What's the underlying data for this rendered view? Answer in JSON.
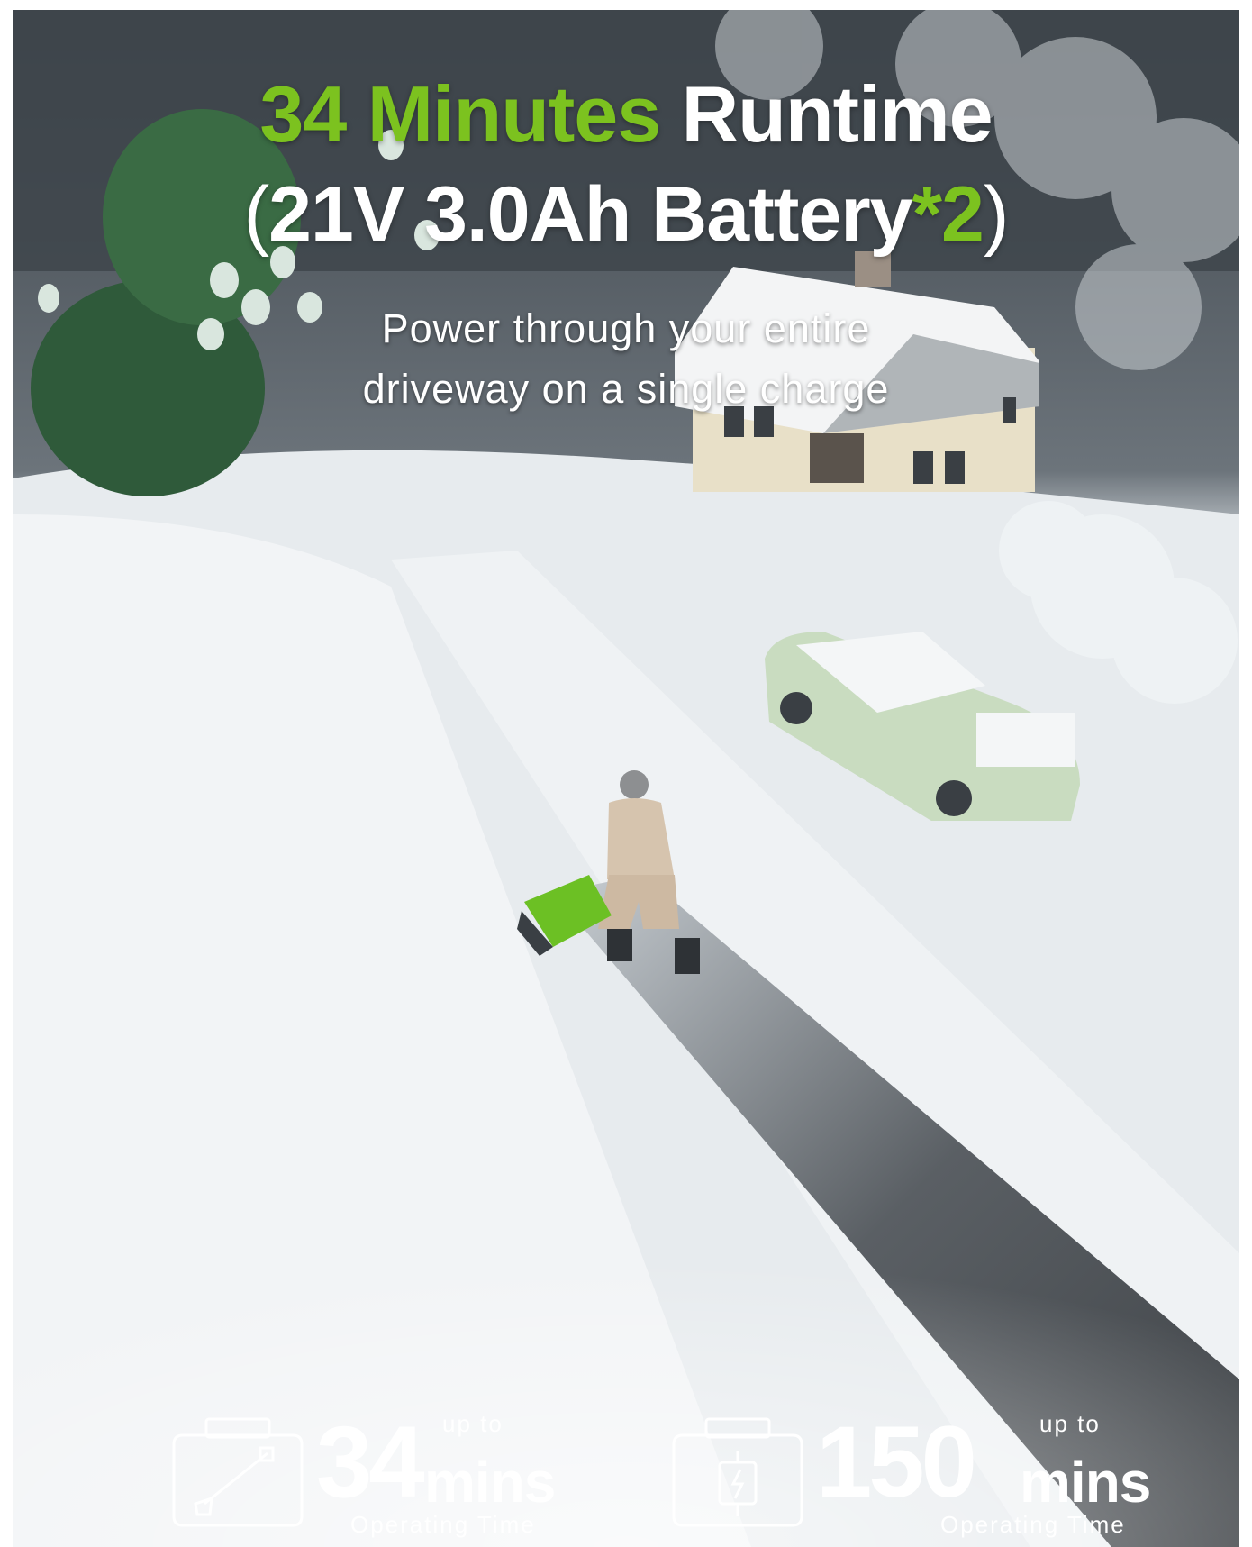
{
  "headline": {
    "line1_highlight": "34 Minutes",
    "line1_rest": "Runtime",
    "line2_open": "(",
    "line2_main": "21V 3.0Ah Battery",
    "line2_highlight": "*2",
    "line2_close": ")"
  },
  "subheadline": {
    "line1": "Power through your entire",
    "line2": "driveway on a single charge"
  },
  "stats": [
    {
      "prefix": "up to",
      "value": "34",
      "unit": "mins",
      "caption": "Operating Time",
      "icon": "battery-case-with-trimmer-icon"
    },
    {
      "prefix": "up to",
      "value": "150",
      "unit": "mins",
      "caption": "Operating Time",
      "icon": "battery-case-with-charge-icon"
    }
  ],
  "colors": {
    "accent_green": "#7cc21f",
    "text_white": "#ffffff",
    "snow": "#eef1f3",
    "driveway": "#4b4e52"
  }
}
